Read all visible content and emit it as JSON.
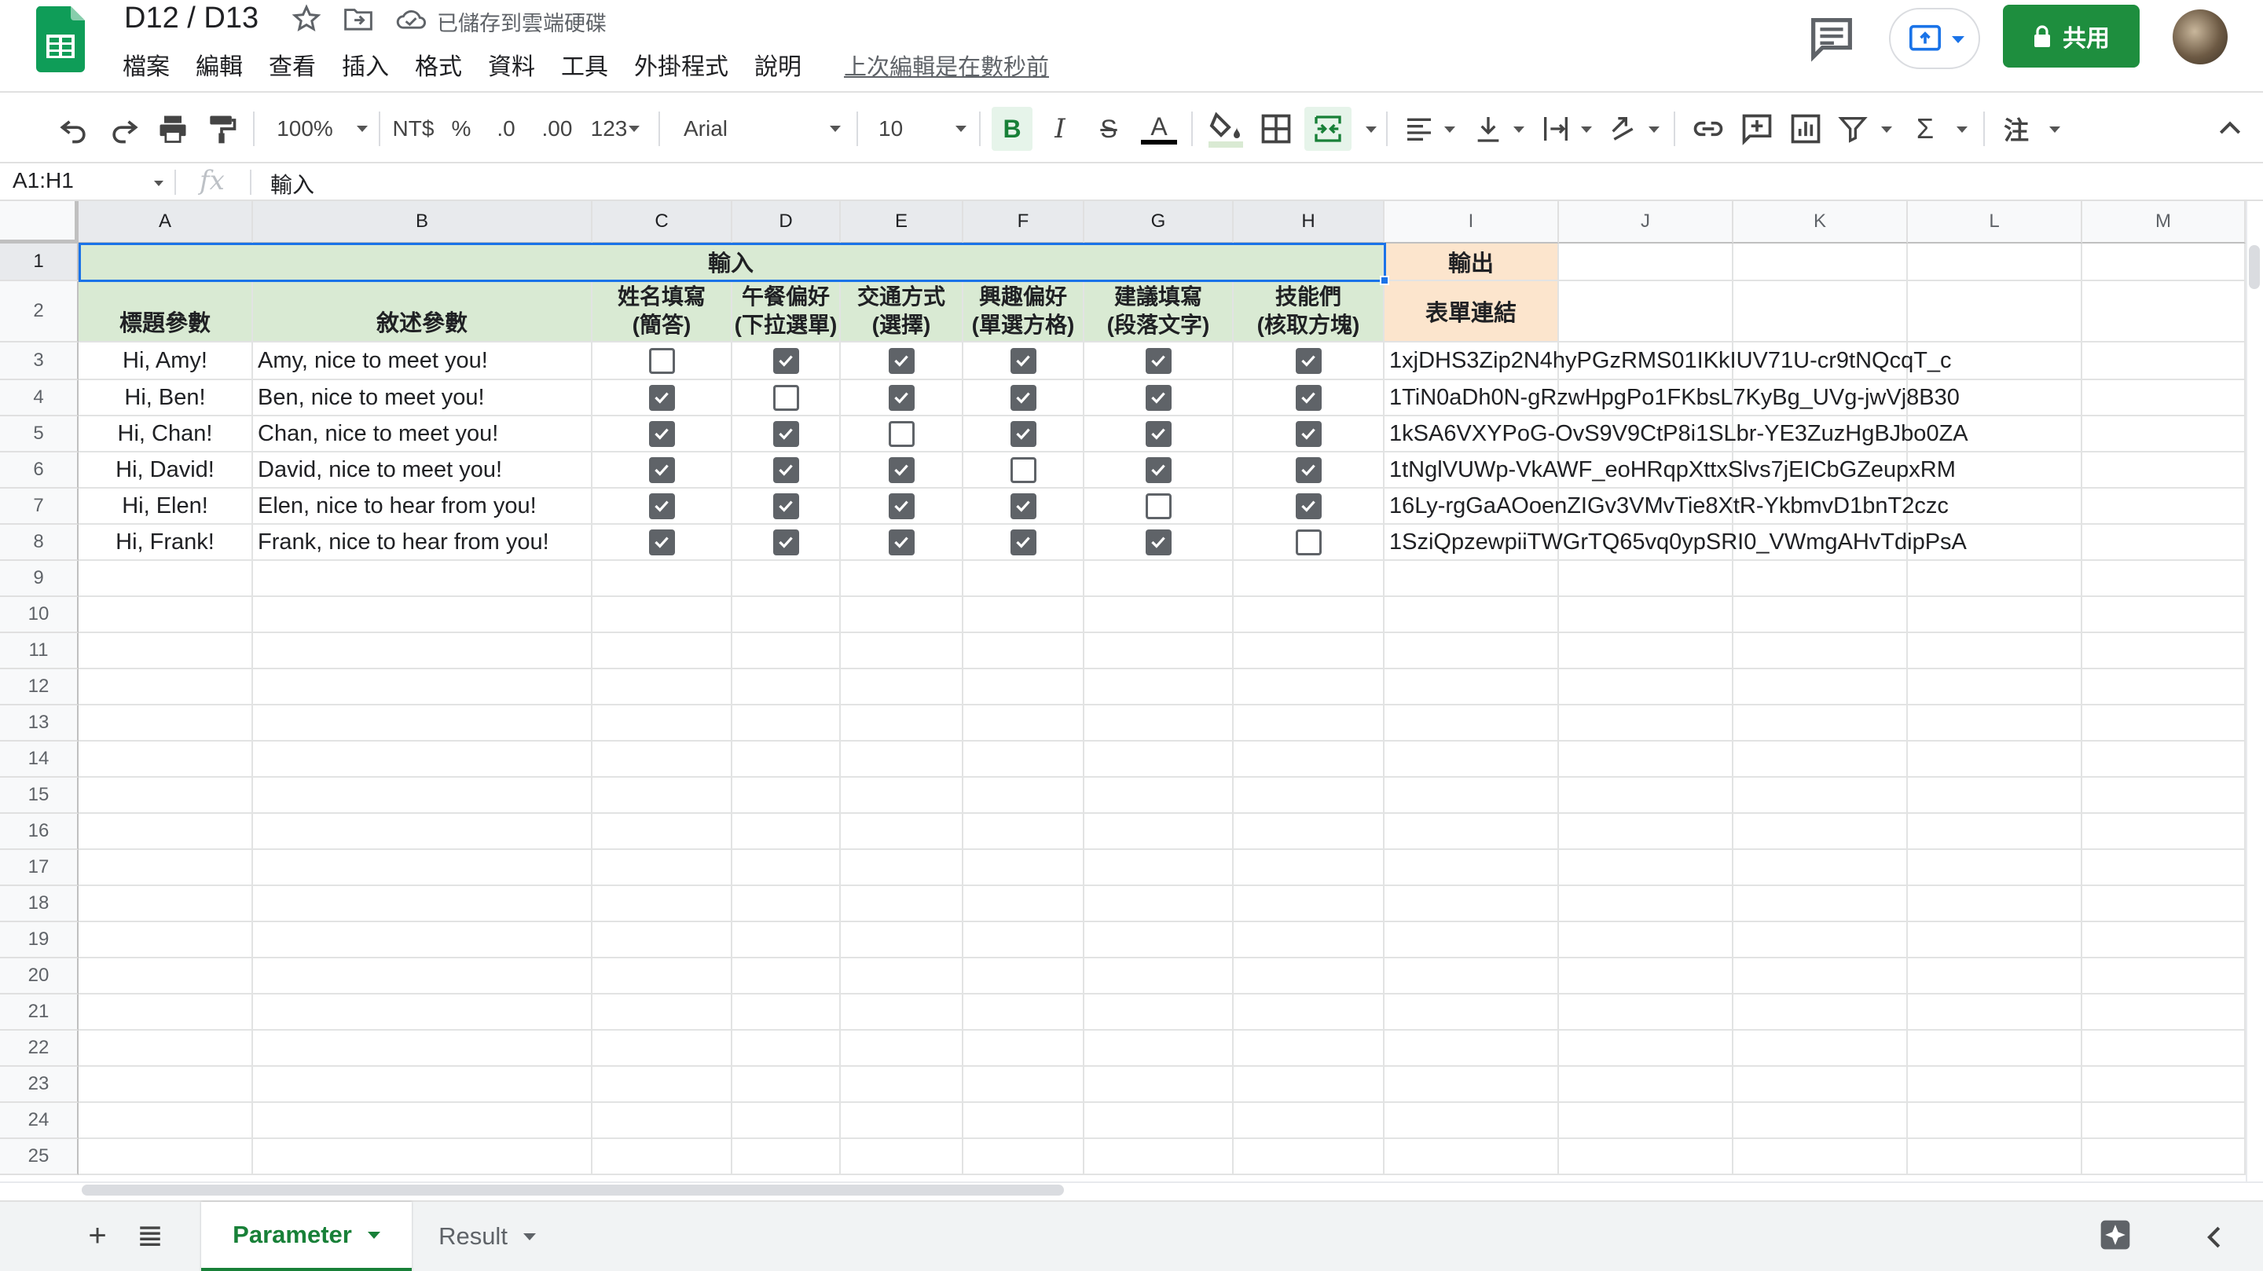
{
  "app": {
    "doc_title": "D12 / D13",
    "save_status": "已儲存到雲端硬碟",
    "last_edit": "上次編輯是在數秒前",
    "share_label": "共用",
    "menu": [
      "檔案",
      "編輯",
      "查看",
      "插入",
      "格式",
      "資料",
      "工具",
      "外掛程式",
      "說明"
    ],
    "brand_color": "#1e8e3e"
  },
  "toolbar": {
    "zoom": "100%",
    "currency": "NT$",
    "percent": "%",
    "dec_less": ".0",
    "dec_more": ".00",
    "number_format": "123",
    "font": "Arial",
    "font_size": "10",
    "bold": "B",
    "italic": "I",
    "strike": "S",
    "text_color": "A",
    "input_tools": "注"
  },
  "formula_bar": {
    "name_box": "A1:H1",
    "fx": "fx",
    "value": "輸入"
  },
  "columns": [
    "A",
    "B",
    "C",
    "D",
    "E",
    "F",
    "G",
    "H",
    "I",
    "J",
    "K",
    "L",
    "M"
  ],
  "rows": [
    "1",
    "2",
    "3",
    "4",
    "5",
    "6",
    "7",
    "8",
    "9",
    "10",
    "11",
    "12",
    "13",
    "14",
    "15",
    "16",
    "17",
    "18",
    "19",
    "20",
    "21",
    "22",
    "23",
    "24",
    "25"
  ],
  "sheet": {
    "input_header": "輸入",
    "output_header": "輸出",
    "col_headers": {
      "a": "標題參數",
      "b": "敘述參數",
      "c1": "姓名填寫",
      "c2": "(簡答)",
      "d1": "午餐偏好",
      "d2": "(下拉選單)",
      "e1": "交通方式",
      "e2": "(選擇)",
      "f1": "興趣偏好",
      "f2": "(單選方格)",
      "g1": "建議填寫",
      "g2": "(段落文字)",
      "h1": "技能們",
      "h2": "(核取方塊)",
      "i": "表單連結"
    },
    "data_rows": [
      {
        "title": "Hi, Amy!",
        "desc": "Amy, nice to meet you!",
        "checks": [
          false,
          true,
          true,
          true,
          true,
          true
        ],
        "link": "1xjDHS3Zip2N4hyPGzRMS01IKkIUV71U-cr9tNQcqT_c"
      },
      {
        "title": "Hi, Ben!",
        "desc": "Ben, nice to meet you!",
        "checks": [
          true,
          false,
          true,
          true,
          true,
          true
        ],
        "link": "1TiN0aDh0N-gRzwHpgPo1FKbsL7KyBg_UVg-jwVj8B30"
      },
      {
        "title": "Hi, Chan!",
        "desc": "Chan, nice to meet you!",
        "checks": [
          true,
          true,
          false,
          true,
          true,
          true
        ],
        "link": "1kSA6VXYPoG-OvS9V9CtP8i1SLbr-YE3ZuzHgBJbo0ZA"
      },
      {
        "title": "Hi, David!",
        "desc": "David, nice to meet you!",
        "checks": [
          true,
          true,
          true,
          false,
          true,
          true
        ],
        "link": "1tNglVUWp-VkAWF_eoHRqpXttxSlvs7jEICbGZeupxRM"
      },
      {
        "title": "Hi, Elen!",
        "desc": "Elen, nice to hear from you!",
        "checks": [
          true,
          true,
          true,
          true,
          false,
          true
        ],
        "link": "16Ly-rgGaAOoenZIGv3VMvTie8XtR-YkbmvD1bnT2czc"
      },
      {
        "title": "Hi, Frank!",
        "desc": "Frank, nice to hear from you!",
        "checks": [
          true,
          true,
          true,
          true,
          true,
          false
        ],
        "link": "1SziQpzewpiiTWGrTQ65vq0ypSRI0_VWmgAHvTdipPsA"
      }
    ]
  },
  "tabs": [
    {
      "label": "Parameter",
      "active": true
    },
    {
      "label": "Result",
      "active": false
    }
  ]
}
